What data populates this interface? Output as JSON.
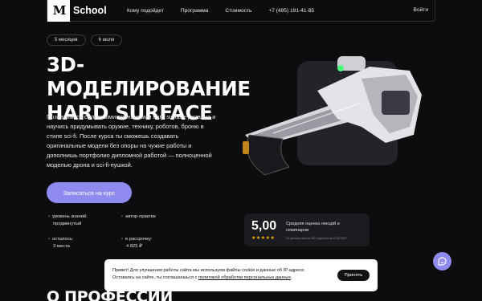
{
  "header": {
    "logo_mark": "M",
    "logo_text": "School",
    "nav": [
      "Кому подойдет",
      "Программа",
      "Стоимость",
      "+7 (495) 191-41-85"
    ],
    "login": "Войти"
  },
  "hero": {
    "tags": [
      "5 месяцев",
      "6 июля"
    ],
    "title_line1": "3D-МОДЕЛИРОВАНИЕ",
    "title_line2": "HARD SURFACE",
    "description": "Познакомься с главными принципами hard surface-дизайна и научись придумывать оружие, технику, роботов, броню в стиле sci-fi. После курса ты сможешь создавать оригинальные модели без опоры на чужие работы и дополнишь портфолио дипломной работой — полноценной моделью дрона и sci-fi-пушкой.",
    "cta": "Записаться на курс"
  },
  "facts": [
    {
      "line1": "уровень знаний:",
      "line2": "продвинутый"
    },
    {
      "line1": "автор-практик",
      "line2": ""
    },
    {
      "line1": "осталось:",
      "line2": "3 места"
    },
    {
      "line1": "в рассрочку:",
      "line2": "4 825 ₽"
    }
  ],
  "rating": {
    "value": "5,00",
    "stars": "★★★★★",
    "label": "Средняя оценка лекций и семинаров",
    "note": "По данным опроса 140 студентов на 11.05.2022"
  },
  "cookie": {
    "text_part1": "Привет! Для улучшения работы сайта мы используем файлы cookie и данные об IP-адресе. Оставаясь на сайте, ты соглашаешься с ",
    "link": "политикой обработки персональных данных",
    "text_part2": ".",
    "button": "Принять"
  },
  "section": {
    "title": "О ПРОФЕССИИ"
  },
  "colors": {
    "accent": "#8f8af0",
    "background": "#0d0d0f",
    "star": "#f4b400"
  },
  "icons": [
    "logo-icon",
    "chat-icon",
    "bullet-icon"
  ]
}
